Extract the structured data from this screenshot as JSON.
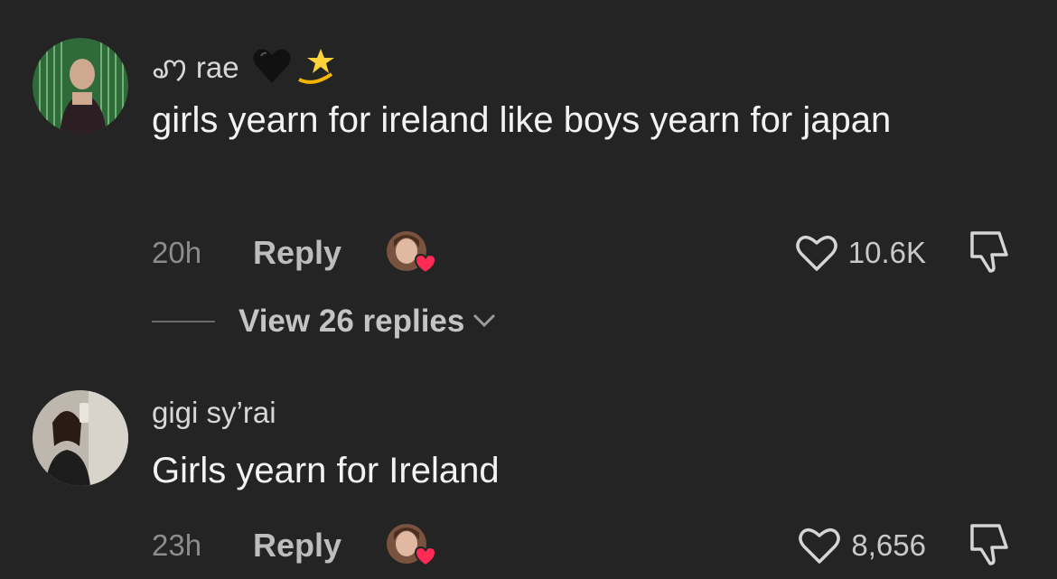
{
  "comments": [
    {
      "username": "ꩇ rae",
      "text": "girls yearn for ireland like boys yearn for japan",
      "time": "20h",
      "reply_label": "Reply",
      "likes": "10.6K",
      "icons": [
        "black-heart-emoji",
        "dizzy-star-emoji"
      ]
    },
    {
      "username": "gigi sy’rai",
      "text": "Girls yearn for Ireland",
      "time": "23h",
      "reply_label": "Reply",
      "likes": "8,656"
    }
  ],
  "view_replies_label": "View 26 replies",
  "colors": {
    "background": "#242424",
    "creator_heart": "#fe2c55"
  }
}
